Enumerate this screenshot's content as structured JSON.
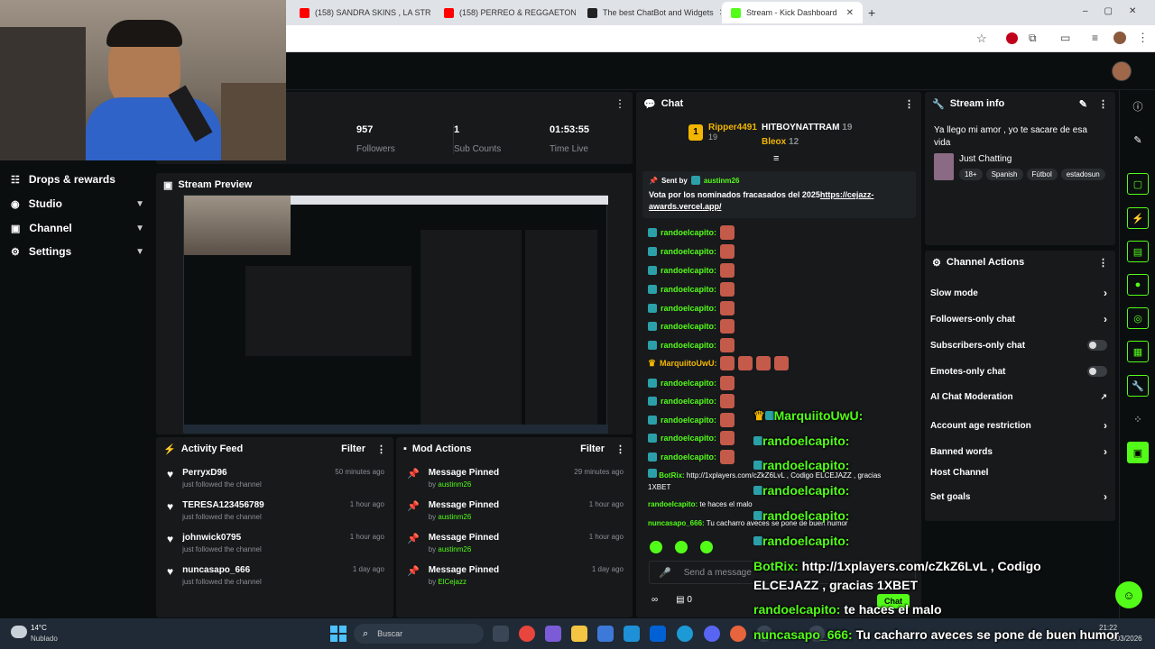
{
  "browser": {
    "tabs": [
      {
        "label": "(158) SANDRA SKINS , LA STRE",
        "color": "#ff0000"
      },
      {
        "label": "(158) PERREO & REGGAETON C",
        "color": "#ff0000"
      },
      {
        "label": "The best ChatBot and Widgets",
        "color": "#222222"
      },
      {
        "label": "Stream - Kick Dashboard",
        "color": "#53fc18"
      }
    ],
    "new_tab": "+"
  },
  "stats": [
    {
      "value": "957",
      "label": "Followers"
    },
    {
      "value": "1",
      "label": "Sub Counts"
    },
    {
      "value": "01:53:55",
      "label": "Time Live"
    }
  ],
  "sidebar": {
    "items": [
      {
        "label": "Drops & rewards"
      },
      {
        "label": "Studio"
      },
      {
        "label": "Channel"
      },
      {
        "label": "Settings"
      }
    ]
  },
  "stream_preview": {
    "title": "Stream Preview"
  },
  "activity_feed": {
    "title": "Activity Feed",
    "filter": "Filter",
    "items": [
      {
        "name": "PerryxD96",
        "sub": "just followed the channel",
        "time": "50 minutes ago"
      },
      {
        "name": "TERESA123456789",
        "sub": "just followed the channel",
        "time": "1 hour ago"
      },
      {
        "name": "johnwick0795",
        "sub": "just followed the channel",
        "time": "1 hour ago"
      },
      {
        "name": "nuncasapo_666",
        "sub": "just followed the channel",
        "time": "1 day ago"
      }
    ]
  },
  "mod_actions": {
    "title": "Mod Actions",
    "filter": "Filter",
    "items": [
      {
        "action": "Message Pinned",
        "by": "by",
        "user": "austinm26",
        "time": "29 minutes ago"
      },
      {
        "action": "Message Pinned",
        "by": "by",
        "user": "austinm26",
        "time": "1 hour ago"
      },
      {
        "action": "Message Pinned",
        "by": "by",
        "user": "austinm26",
        "time": "1 hour ago"
      },
      {
        "action": "Message Pinned",
        "by": "by",
        "user": "ElCejazz",
        "time": "1 day ago"
      }
    ]
  },
  "chat": {
    "title": "Chat",
    "top_gifters": [
      {
        "rank": "1",
        "name": "Ripper4491",
        "count": "19"
      },
      {
        "name": "HITBOYNATTRAM",
        "count": "19"
      },
      {
        "name": "Bleox",
        "count": "12"
      }
    ],
    "pinned": {
      "sent_by": "Sent by",
      "user": "austinm26",
      "text": "Vota por los nominados fracasados del 2025",
      "link": "https://cejazz-awards.vercel.app/"
    },
    "messages": [
      {
        "user": "randoelcapito:"
      },
      {
        "user": "randoelcapito:"
      },
      {
        "user": "randoelcapito:"
      },
      {
        "user": "randoelcapito:"
      },
      {
        "user": "randoelcapito:"
      },
      {
        "user": "randoelcapito:"
      },
      {
        "user": "randoelcapito:"
      },
      {
        "user": "MarquiitoUwU:"
      },
      {
        "user": "randoelcapito:"
      },
      {
        "user": "randoelcapito:"
      },
      {
        "user": "randoelcapito:"
      },
      {
        "user": "randoelcapito:"
      },
      {
        "user": "randoelcapito:"
      }
    ],
    "botrix": {
      "user": "BotRix:",
      "text": "http://1xplayers.com/cZkZ6LvL , Codigo ELCEJAZZ , gracias 1XBET"
    },
    "rando_last": {
      "user": "randoelcapito:",
      "text": "te haces el malo"
    },
    "nunca": {
      "user": "nuncasapo_666:",
      "text": "Tu cacharro aveces se pone de buen humor"
    },
    "input_placeholder": "Send a message",
    "viewer_count": "0",
    "chat_button": "Chat"
  },
  "stream_info": {
    "title": "Stream info",
    "stream_title": "Ya llego mi amor , yo te sacare de esa vida",
    "category": "Just Chatting",
    "tags": [
      "18+",
      "Spanish",
      "Fútbol",
      "estadosun"
    ]
  },
  "channel_actions": {
    "title": "Channel Actions",
    "items": [
      {
        "label": "Slow mode",
        "control": "arrow"
      },
      {
        "label": "Followers-only chat",
        "control": "arrow"
      },
      {
        "label": "Subscribers-only chat",
        "control": "toggle"
      },
      {
        "label": "Emotes-only chat",
        "control": "toggle"
      },
      {
        "label": "AI Chat Moderation",
        "control": "external"
      },
      {
        "label": "Account age restriction",
        "control": "arrow"
      },
      {
        "label": "Banned words",
        "control": "arrow"
      },
      {
        "label": "Host Channel",
        "control": "none"
      },
      {
        "label": "Set goals",
        "control": "arrow"
      }
    ]
  },
  "overlay_chat": {
    "marquiito": "MarquiitoUwU:",
    "rando": "randoelcapito:",
    "botrix_user": "BotRix:",
    "botrix_text": "http://1xplayers.com/cZkZ6LvL , Codigo",
    "botrix_text2": "ELCEJAZZ , gracias 1XBET",
    "rando_text": "te haces el malo",
    "nunca_user": "nuncasapo_666:",
    "nunca_text": "Tu cacharro aveces se pone de buen humor"
  },
  "taskbar": {
    "weather_temp": "14°C",
    "weather_desc": "Nublado",
    "search_placeholder": "Buscar",
    "time": "21:22",
    "date": "6/03/2026"
  },
  "colors": {
    "accent": "#53fc18",
    "panel": "#17191b",
    "bg": "#0b0e0f"
  }
}
